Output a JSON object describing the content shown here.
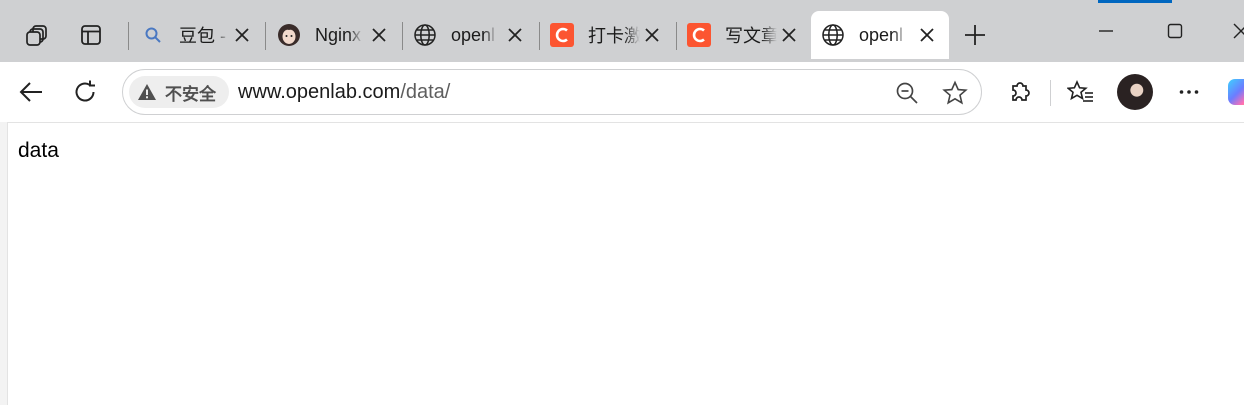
{
  "colors": {
    "tabstrip_bg": "#cfd0d2",
    "accent": "#0067c0",
    "csdn_brand": "#fc5531"
  },
  "tabs": [
    {
      "title": "豆包 -",
      "icon": "search-icon",
      "active": false
    },
    {
      "title": "Nginx",
      "icon": "avatar-favicon",
      "active": false
    },
    {
      "title": "openl",
      "icon": "globe-icon",
      "active": false
    },
    {
      "title": "打卡激",
      "icon": "csdn-icon",
      "active": false
    },
    {
      "title": "写文章",
      "icon": "csdn-icon",
      "active": false
    },
    {
      "title": "openl",
      "icon": "globe-icon",
      "active": true
    }
  ],
  "omnibox": {
    "security_label": "不安全",
    "url_host": "www.openlab.com",
    "url_path": "/data/"
  },
  "page": {
    "body_text": "data"
  }
}
